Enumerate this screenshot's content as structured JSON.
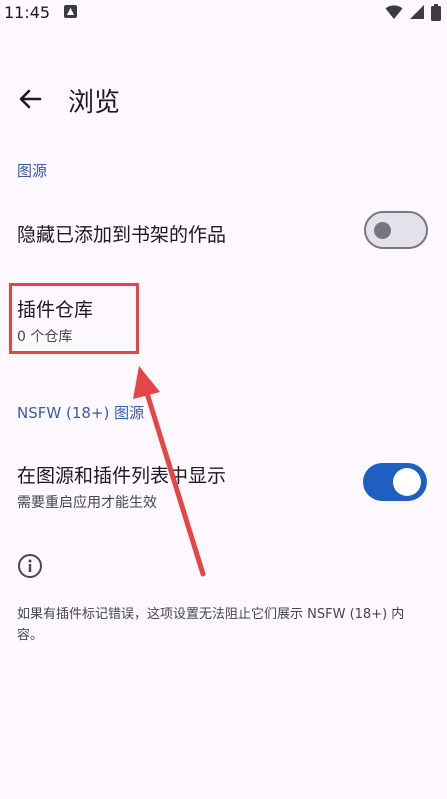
{
  "status_bar": {
    "time": "11:45"
  },
  "app_bar": {
    "title": "浏览"
  },
  "sections": {
    "sources": {
      "label": "图源",
      "hide_in_library": {
        "title": "隐藏已添加到书架的作品",
        "enabled": false
      },
      "extension_repos": {
        "title": "插件仓库",
        "subtitle": "0 个仓库"
      }
    },
    "nsfw": {
      "label": "NSFW (18+) 图源",
      "show_in_lists": {
        "title": "在图源和插件列表中显示",
        "subtitle": "需要重启应用才能生效",
        "enabled": true
      },
      "info_text": "如果有插件标记错误，这项设置无法阻止它们展示 NSFW (18+) 内容。"
    }
  },
  "colors": {
    "accent": "#1f5fc2",
    "section_label": "#3a5ba9",
    "annotation": "#e54545"
  },
  "icons": {
    "back": "arrow-left-icon",
    "info": "info-icon"
  }
}
